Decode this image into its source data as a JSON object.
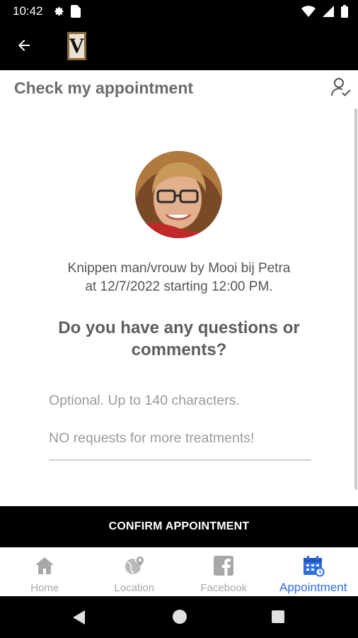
{
  "status_bar": {
    "time": "10:42",
    "icons": [
      "gear-icon",
      "sim-card-icon",
      "wifi-icon",
      "signal-icon",
      "battery-icon"
    ]
  },
  "app_bar": {
    "logo_letter": "V"
  },
  "header": {
    "title": "Check my appointment"
  },
  "appointment": {
    "description_line1": "Knippen man/vrouw by Mooi bij Petra",
    "description_line2": "at 12/7/2022 starting 12:00 PM."
  },
  "comments": {
    "question_line1": "Do you have any questions or",
    "question_line2": "comments?",
    "placeholder_line1": "Optional. Up to 140 characters.",
    "placeholder_line2": "NO requests for more treatments!"
  },
  "confirm_button": {
    "label": "CONFIRM APPOINTMENT"
  },
  "bottom_nav": {
    "items": [
      {
        "label": "Home",
        "icon": "home-icon",
        "active": false
      },
      {
        "label": "Location",
        "icon": "globe-pin-icon",
        "active": false
      },
      {
        "label": "Facebook",
        "icon": "facebook-icon",
        "active": false
      },
      {
        "label": "Appointment",
        "icon": "calendar-icon",
        "active": true
      }
    ]
  },
  "colors": {
    "active_nav": "#2f6fe0",
    "inactive_nav": "#a8a8a8",
    "bar_background": "#000000"
  }
}
